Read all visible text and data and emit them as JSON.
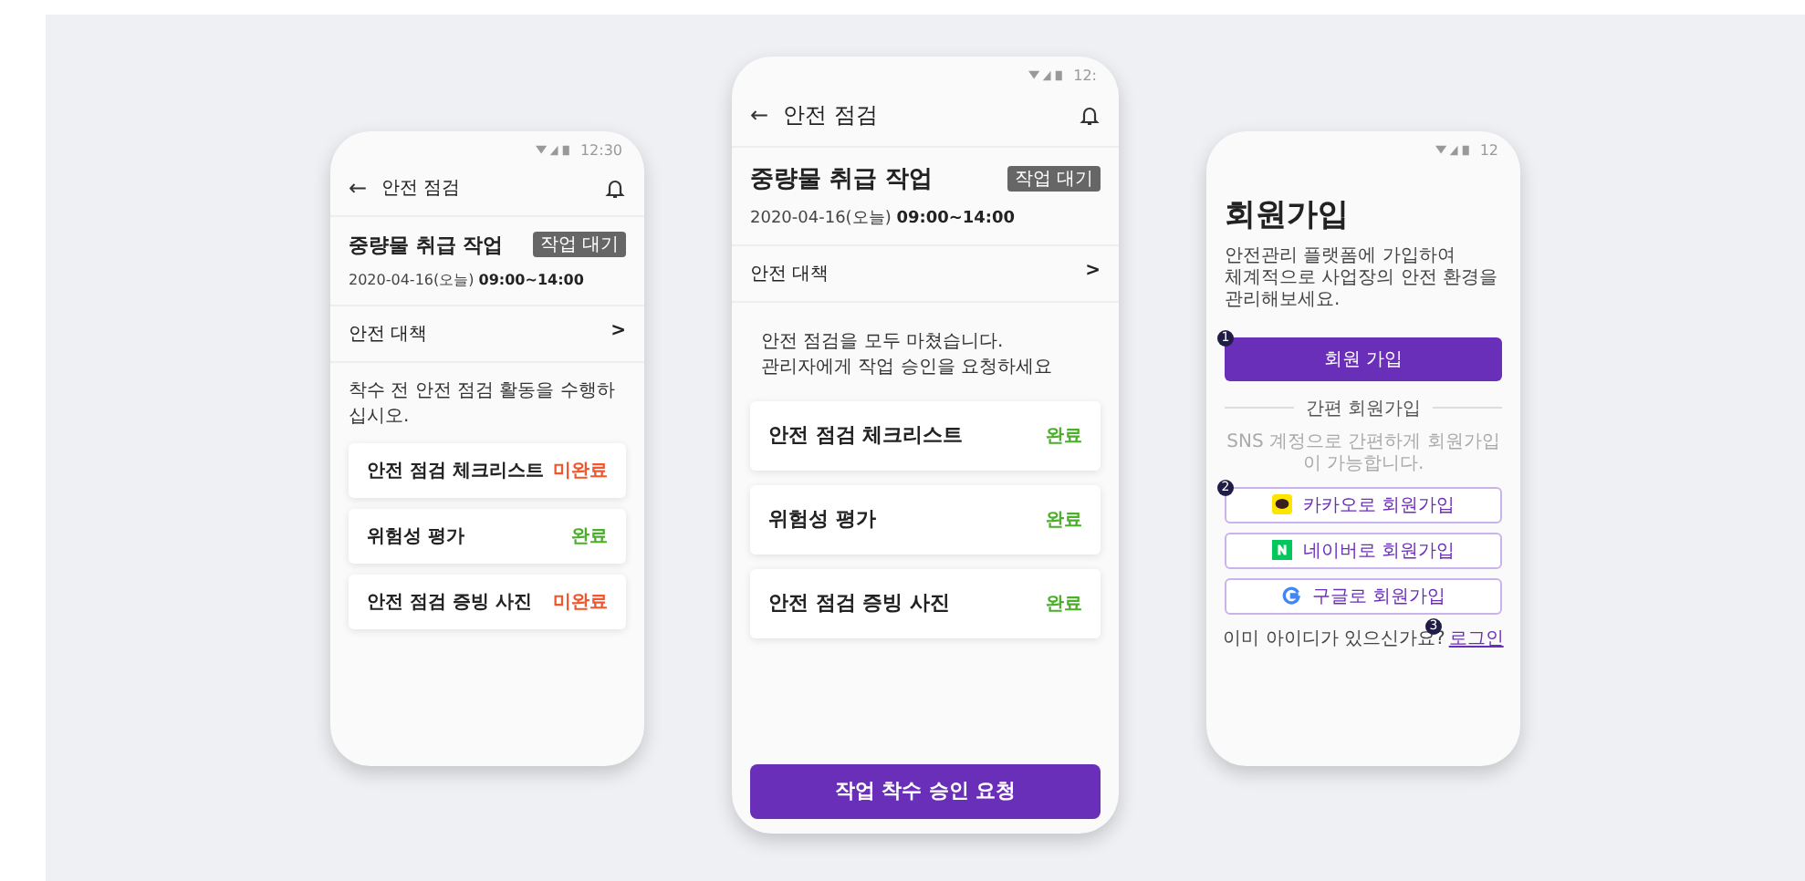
{
  "phones": [
    {
      "kind": "checklist",
      "status_time": "12:30",
      "header": {
        "back": "←",
        "title": "안전 점검"
      },
      "job": {
        "title": "중량물 취급 작업",
        "badge": "작업 대기",
        "date": "2020-04-16(오늘)",
        "time": "09:00~14:00"
      },
      "measures": {
        "label": "안전 대책",
        "chevron": ">"
      },
      "message": "착수 전 안전 점검 활동을 수행하십시오.",
      "items": [
        {
          "label": "안전 점검 체크리스트",
          "status": "미완료",
          "complete": false
        },
        {
          "label": "위험성 평가",
          "status": "완료",
          "complete": true
        },
        {
          "label": "안전 점검 증빙 사진",
          "status": "미완료",
          "complete": false
        }
      ]
    },
    {
      "kind": "checklist",
      "status_time": "12:",
      "header": {
        "back": "←",
        "title": "안전 점검"
      },
      "job": {
        "title": "중량물 취급 작업",
        "badge": "작업 대기",
        "date": "2020-04-16(오늘)",
        "time": "09:00~14:00"
      },
      "measures": {
        "label": "안전 대책",
        "chevron": ">"
      },
      "message": "안전 점검을 모두 마쳤습니다.\n관리자에게 작업 승인을 요청하세요",
      "items": [
        {
          "label": "안전 점검 체크리스트",
          "status": "완료",
          "complete": true
        },
        {
          "label": "위험성 평가",
          "status": "완료",
          "complete": true
        },
        {
          "label": "안전 점검 증빙 사진",
          "status": "완료",
          "complete": true
        }
      ],
      "action": "작업 착수 승인 요청"
    },
    {
      "kind": "signup",
      "status_time": "12",
      "title": "회원가입",
      "description": "안전관리 플랫폼에 가입하여\n체계적으로 사업장의 안전 환경을 관리해보세요.",
      "primary": {
        "label": "회원 가입",
        "marker": "1"
      },
      "divider": "간편 회원가입",
      "sns_note": "SNS 계정으로 간편하게 회원가입이 가능합니다.",
      "sns_marker": "2",
      "social": [
        {
          "kind": "kakao",
          "label": "카카오로 회원가입"
        },
        {
          "kind": "naver",
          "label": "네이버로 회원가입"
        },
        {
          "kind": "google",
          "label": "구글로 회원가입"
        }
      ],
      "login": {
        "prompt": "이미 아이디가 있으신가요?",
        "link": "로그인",
        "marker": "3"
      }
    }
  ]
}
